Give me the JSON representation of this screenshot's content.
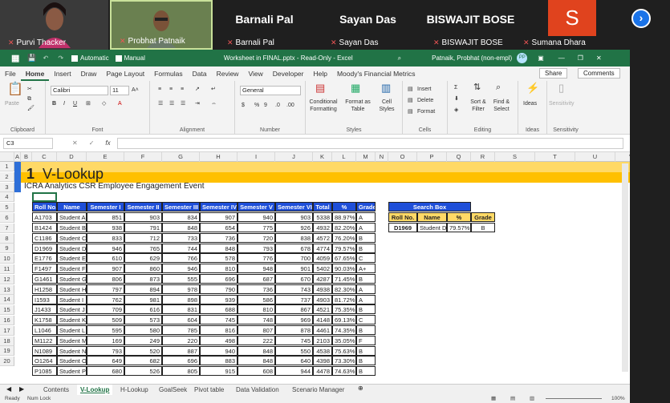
{
  "meeting": {
    "participants": [
      {
        "name": "Purvi Thacker",
        "type": "video",
        "muted": true
      },
      {
        "name": "Probhat Patnaik",
        "type": "video",
        "muted": true
      },
      {
        "name": "Barnali Pal",
        "type": "name",
        "muted": true
      },
      {
        "name": "Sayan Das",
        "type": "name",
        "muted": true
      },
      {
        "name": "BISWAJIT BOSE",
        "type": "name",
        "muted": true
      },
      {
        "name": "Sumana Dhara",
        "type": "avatar",
        "initial": "S",
        "muted": true
      }
    ],
    "next_icon": "chevron-right-icon"
  },
  "titlebar": {
    "autosave": "Automatic",
    "manual": "Manual",
    "doc_title": "Worksheet in FINAL.pptx - Read-Only - Excel",
    "user": "Patnaik, Probhat (non-empl)",
    "user_initials": "PP"
  },
  "ribbon_tabs": [
    "File",
    "Home",
    "Insert",
    "Draw",
    "Page Layout",
    "Formulas",
    "Data",
    "Review",
    "View",
    "Developer",
    "Help",
    "Moody's Financial Metrics"
  ],
  "ribbon_actions": {
    "share": "Share",
    "comments": "Comments"
  },
  "ribbon": {
    "clipboard": {
      "label": "Clipboard",
      "paste": "Paste"
    },
    "font": {
      "label": "Font",
      "name": "Calibri",
      "size": "11"
    },
    "alignment": {
      "label": "Alignment"
    },
    "number": {
      "label": "Number",
      "format": "General"
    },
    "styles": {
      "label": "Styles",
      "cond": "Conditional\nFormatting",
      "table": "Format as\nTable",
      "cell": "Cell\nStyles"
    },
    "cells": {
      "label": "Cells",
      "insert": "Insert",
      "delete": "Delete",
      "format": "Format"
    },
    "editing": {
      "label": "Editing",
      "sort": "Sort &\nFilter",
      "find": "Find &\nSelect"
    },
    "ideas": {
      "label": "Ideas",
      "btn": "Ideas"
    },
    "sensitivity": {
      "label": "Sensitivity",
      "btn": "Sensitivity"
    }
  },
  "formula_bar": {
    "name_box": "C3",
    "fx": "fx",
    "value": ""
  },
  "columns": [
    "A",
    "B",
    "C",
    "D",
    "E",
    "F",
    "G",
    "H",
    "I",
    "J",
    "K",
    "L",
    "M",
    "N",
    "O",
    "P",
    "Q",
    "R",
    "S",
    "T",
    "U",
    "V"
  ],
  "rows": [
    "1",
    "2",
    "3",
    "4",
    "5",
    "6",
    "7",
    "8",
    "9",
    "10",
    "11",
    "12",
    "13",
    "14",
    "15",
    "16",
    "17",
    "18",
    "19",
    "20"
  ],
  "sheet": {
    "title_num": "1",
    "title": "V-Lookup",
    "subtitle": "ICRA Analytics CSR Employee Engagement Event",
    "headers": [
      "Roll No.",
      "Name",
      "Semester I",
      "Semester II",
      "Semester III",
      "Semester IV",
      "Semester V",
      "Semester VI",
      "Total",
      "%",
      "Grade"
    ],
    "data": [
      [
        "A1703",
        "Student A",
        "851",
        "903",
        "834",
        "907",
        "940",
        "903",
        "5338",
        "88.97%",
        "A"
      ],
      [
        "B1424",
        "Student B",
        "938",
        "791",
        "848",
        "654",
        "775",
        "926",
        "4932",
        "82.20%",
        "A"
      ],
      [
        "C1186",
        "Student C",
        "833",
        "712",
        "733",
        "736",
        "720",
        "838",
        "4572",
        "76.20%",
        "B"
      ],
      [
        "D1969",
        "Student D",
        "946",
        "765",
        "744",
        "848",
        "793",
        "678",
        "4774",
        "79.57%",
        "B"
      ],
      [
        "E1776",
        "Student E",
        "610",
        "629",
        "766",
        "578",
        "776",
        "700",
        "4059",
        "67.65%",
        "C"
      ],
      [
        "F1497",
        "Student F",
        "907",
        "860",
        "946",
        "810",
        "948",
        "901",
        "5402",
        "90.03%",
        "A+"
      ],
      [
        "G1461",
        "Student G",
        "806",
        "873",
        "555",
        "696",
        "687",
        "670",
        "4287",
        "71.45%",
        "B"
      ],
      [
        "H1258",
        "Student H",
        "797",
        "894",
        "978",
        "790",
        "736",
        "743",
        "4938",
        "82.30%",
        "A"
      ],
      [
        "I1593",
        "Student I",
        "762",
        "981",
        "898",
        "939",
        "586",
        "737",
        "4903",
        "81.72%",
        "A"
      ],
      [
        "J1433",
        "Student J",
        "709",
        "616",
        "831",
        "688",
        "810",
        "867",
        "4521",
        "75.35%",
        "B"
      ],
      [
        "K1758",
        "Student K",
        "509",
        "573",
        "604",
        "745",
        "748",
        "969",
        "4148",
        "69.13%",
        "C"
      ],
      [
        "L1046",
        "Student L",
        "595",
        "580",
        "785",
        "816",
        "807",
        "878",
        "4461",
        "74.35%",
        "B"
      ],
      [
        "M1122",
        "Student M",
        "169",
        "249",
        "220",
        "498",
        "222",
        "745",
        "2103",
        "35.05%",
        "F"
      ],
      [
        "N1089",
        "Student N",
        "793",
        "520",
        "887",
        "940",
        "848",
        "550",
        "4538",
        "75.63%",
        "B"
      ],
      [
        "O1264",
        "Student O",
        "649",
        "682",
        "696",
        "883",
        "848",
        "640",
        "4398",
        "73.30%",
        "B"
      ],
      [
        "P1085",
        "Student P",
        "680",
        "526",
        "805",
        "915",
        "608",
        "944",
        "4478",
        "74.63%",
        "B"
      ]
    ],
    "search": {
      "title": "Search Box",
      "headers": [
        "Roll No.",
        "Name",
        "%",
        "Grade"
      ],
      "values": [
        "D1969",
        "Student D",
        "79.57%",
        "B"
      ]
    }
  },
  "sheet_tabs": [
    "Contents",
    "V-Lookup",
    "H-Lookup",
    "GoalSeek",
    "Pivot table",
    "Data Validation",
    "Scenario Manager"
  ],
  "status": {
    "ready": "Ready",
    "numlock": "Num Lock",
    "zoom": "100%"
  }
}
